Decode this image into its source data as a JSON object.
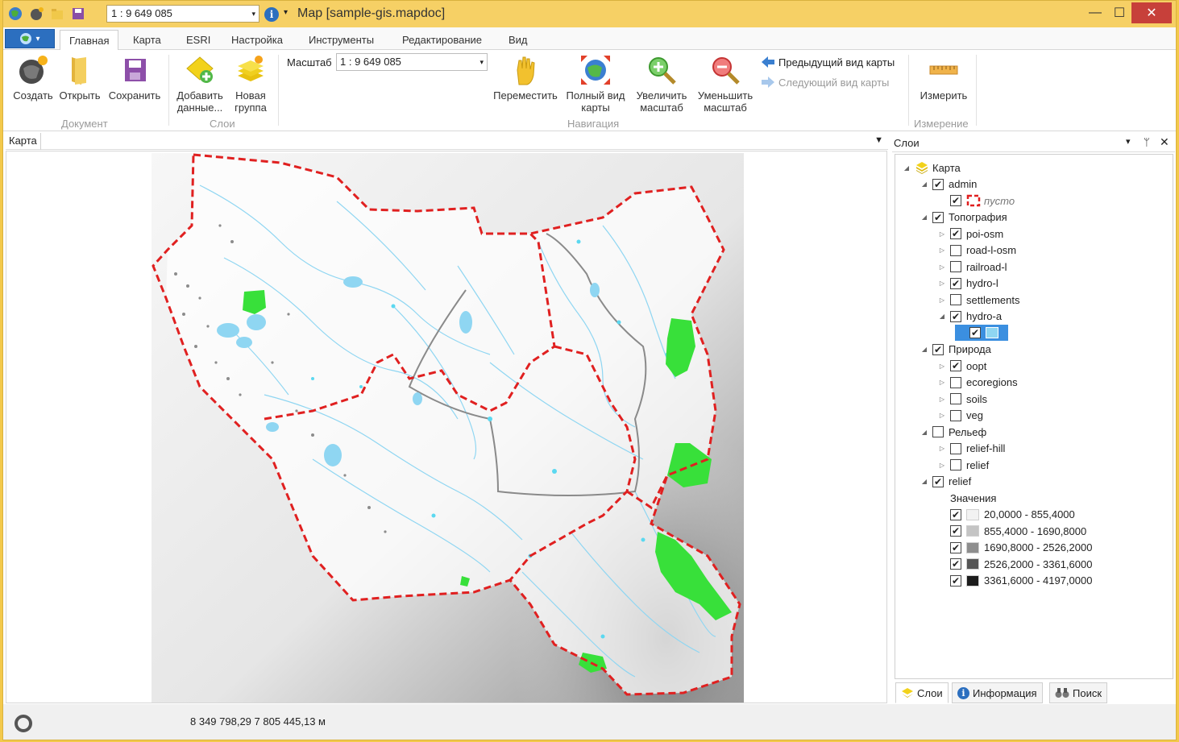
{
  "titlebar": {
    "scale_value": "1 : 9 649 085",
    "title": "Map [sample-gis.mapdoc]",
    "minimize_glyph": "—",
    "maximize_glyph": "☐",
    "close_glyph": "✕",
    "info_glyph": "i",
    "dropdown_glyph": "▾"
  },
  "app_button": {
    "icon": "globe-icon",
    "glyph": "▾"
  },
  "tabs": [
    {
      "label": "Главная"
    },
    {
      "label": "Карта"
    },
    {
      "label": "ESRI"
    },
    {
      "label": "Настройка"
    },
    {
      "label": "Инструменты"
    },
    {
      "label": "Редактирование"
    },
    {
      "label": "Вид"
    }
  ],
  "ribbon": {
    "document": {
      "label": "Документ",
      "create": "Создать",
      "open": "Открыть",
      "save": "Сохранить"
    },
    "layers": {
      "label": "Слои",
      "add_data_1": "Добавить",
      "add_data_2": "данные...",
      "new_group_1": "Новая",
      "new_group_2": "группа"
    },
    "navigation": {
      "label": "Навигация",
      "scale_label": "Масштаб",
      "scale_value": "1 : 9 649 085",
      "pan": "Переместить",
      "full_extent_1": "Полный вид",
      "full_extent_2": "карты",
      "zoom_in_1": "Увеличить",
      "zoom_in_2": "масштаб",
      "zoom_out_1": "Уменьшить",
      "zoom_out_2": "масштаб",
      "prev_view": "Предыдущий вид карты",
      "next_view": "Следующий вид карты"
    },
    "measure": {
      "label": "Измерение",
      "measure": "Измерить"
    }
  },
  "map_panel": {
    "tab_label": "Карта",
    "menu_glyph": "▼"
  },
  "layers_panel": {
    "title": "Слои",
    "pin_glyph": "ᛘ",
    "close_glyph": "✕",
    "dropdown_glyph": "▾",
    "tree": [
      {
        "label": "Карта",
        "indent": 0,
        "twisty": "◢",
        "kind": "root",
        "checked": null
      },
      {
        "label": "admin",
        "indent": 1,
        "twisty": "◢",
        "kind": "layer",
        "checked": true
      },
      {
        "label": "пусто",
        "indent": 2,
        "twisty": "",
        "kind": "legend-empty",
        "checked": true
      },
      {
        "label": "Топография",
        "indent": 1,
        "twisty": "◢",
        "kind": "layer",
        "checked": true
      },
      {
        "label": "poi-osm",
        "indent": 2,
        "twisty": "▷",
        "kind": "layer",
        "checked": true
      },
      {
        "label": "road-l-osm",
        "indent": 2,
        "twisty": "▷",
        "kind": "layer",
        "checked": false
      },
      {
        "label": "railroad-l",
        "indent": 2,
        "twisty": "▷",
        "kind": "layer",
        "checked": false
      },
      {
        "label": "hydro-l",
        "indent": 2,
        "twisty": "▷",
        "kind": "layer",
        "checked": true
      },
      {
        "label": "settlements",
        "indent": 2,
        "twisty": "▷",
        "kind": "layer",
        "checked": false
      },
      {
        "label": "hydro-a",
        "indent": 2,
        "twisty": "◢",
        "kind": "layer",
        "checked": true
      },
      {
        "label": "",
        "indent": 3,
        "twisty": "",
        "kind": "legend-fill",
        "checked": true
      },
      {
        "label": "Природа",
        "indent": 1,
        "twisty": "◢",
        "kind": "layer",
        "checked": true
      },
      {
        "label": "oopt",
        "indent": 2,
        "twisty": "▷",
        "kind": "layer",
        "checked": true
      },
      {
        "label": "ecoregions",
        "indent": 2,
        "twisty": "▷",
        "kind": "layer",
        "checked": false
      },
      {
        "label": "soils",
        "indent": 2,
        "twisty": "▷",
        "kind": "layer",
        "checked": false
      },
      {
        "label": "veg",
        "indent": 2,
        "twisty": "▷",
        "kind": "layer",
        "checked": false
      },
      {
        "label": "Рельеф",
        "indent": 1,
        "twisty": "◢",
        "kind": "layer",
        "checked": false
      },
      {
        "label": "relief-hill",
        "indent": 2,
        "twisty": "▷",
        "kind": "layer",
        "checked": false
      },
      {
        "label": "relief",
        "indent": 2,
        "twisty": "▷",
        "kind": "layer",
        "checked": false
      },
      {
        "label": "relief",
        "indent": 1,
        "twisty": "◢",
        "kind": "layer",
        "checked": true
      },
      {
        "label": "Значения",
        "indent": 2,
        "twisty": "",
        "kind": "caption",
        "checked": null
      },
      {
        "label": "20,0000 - 855,4000",
        "indent": 2,
        "twisty": "",
        "kind": "legend",
        "checked": true,
        "color": "#f2f2f2"
      },
      {
        "label": "855,4000 - 1690,8000",
        "indent": 2,
        "twisty": "",
        "kind": "legend",
        "checked": true,
        "color": "#c4c4c4"
      },
      {
        "label": "1690,8000 - 2526,2000",
        "indent": 2,
        "twisty": "",
        "kind": "legend",
        "checked": true,
        "color": "#8e8e8e"
      },
      {
        "label": "2526,2000 - 3361,6000",
        "indent": 2,
        "twisty": "",
        "kind": "legend",
        "checked": true,
        "color": "#555555"
      },
      {
        "label": "3361,6000 - 4197,0000",
        "indent": 2,
        "twisty": "",
        "kind": "legend",
        "checked": true,
        "color": "#1c1c1c"
      }
    ],
    "bottom_tabs": [
      {
        "label": "Слои",
        "icon": "layers-icon"
      },
      {
        "label": "Информация",
        "icon": "info-icon"
      },
      {
        "label": "Поиск",
        "icon": "binoculars-icon"
      }
    ]
  },
  "status": {
    "coords": "8 349 798,29 7 805 445,13 м"
  },
  "colors": {
    "boundary": "#e02020",
    "water": "#8fd6f2",
    "protected": "#38e03a",
    "title_bar": "#f6d065"
  }
}
